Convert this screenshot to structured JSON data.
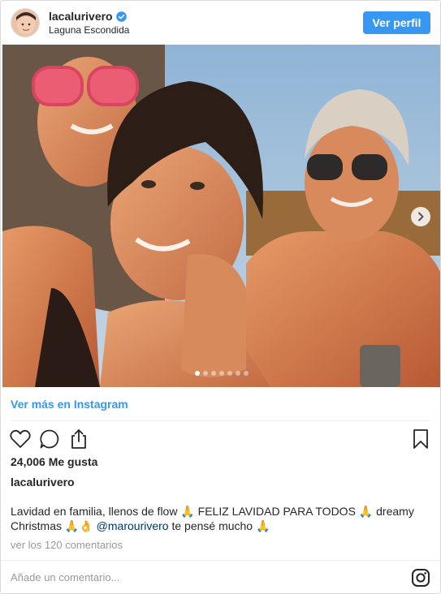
{
  "post": {
    "username": "lacalurivero",
    "location": "Laguna Escondida",
    "view_profile_label": "Ver perfil",
    "see_more_label": "Ver más en Instagram",
    "likes_text": "24,006 Me gusta",
    "caption_owner": "lacalurivero",
    "caption_part1": "Lavidad en familia, llenos de flow ",
    "caption_emoji1": "🙏",
    "caption_part2": " FELIZ LAVIDAD PARA TODOS ",
    "caption_emoji2": "🙏",
    "caption_part3": " dreamy Christmas ",
    "caption_emoji3": "🙏👌",
    "caption_mention": "@marourivero",
    "caption_part4": " te pensé mucho ",
    "caption_emoji4": "🙏",
    "comments_link": "ver los 120 comentarios",
    "comment_placeholder": "Añade un comentario...",
    "carousel": {
      "total": 7,
      "active": 1
    }
  },
  "colors": {
    "accent": "#3897f0",
    "link_dark": "#003569",
    "muted": "#999999",
    "border": "#dbdbdb"
  },
  "icons": [
    "verified-badge-icon",
    "chevron-right-icon",
    "heart-icon",
    "comment-icon",
    "share-icon",
    "bookmark-icon",
    "instagram-icon"
  ]
}
